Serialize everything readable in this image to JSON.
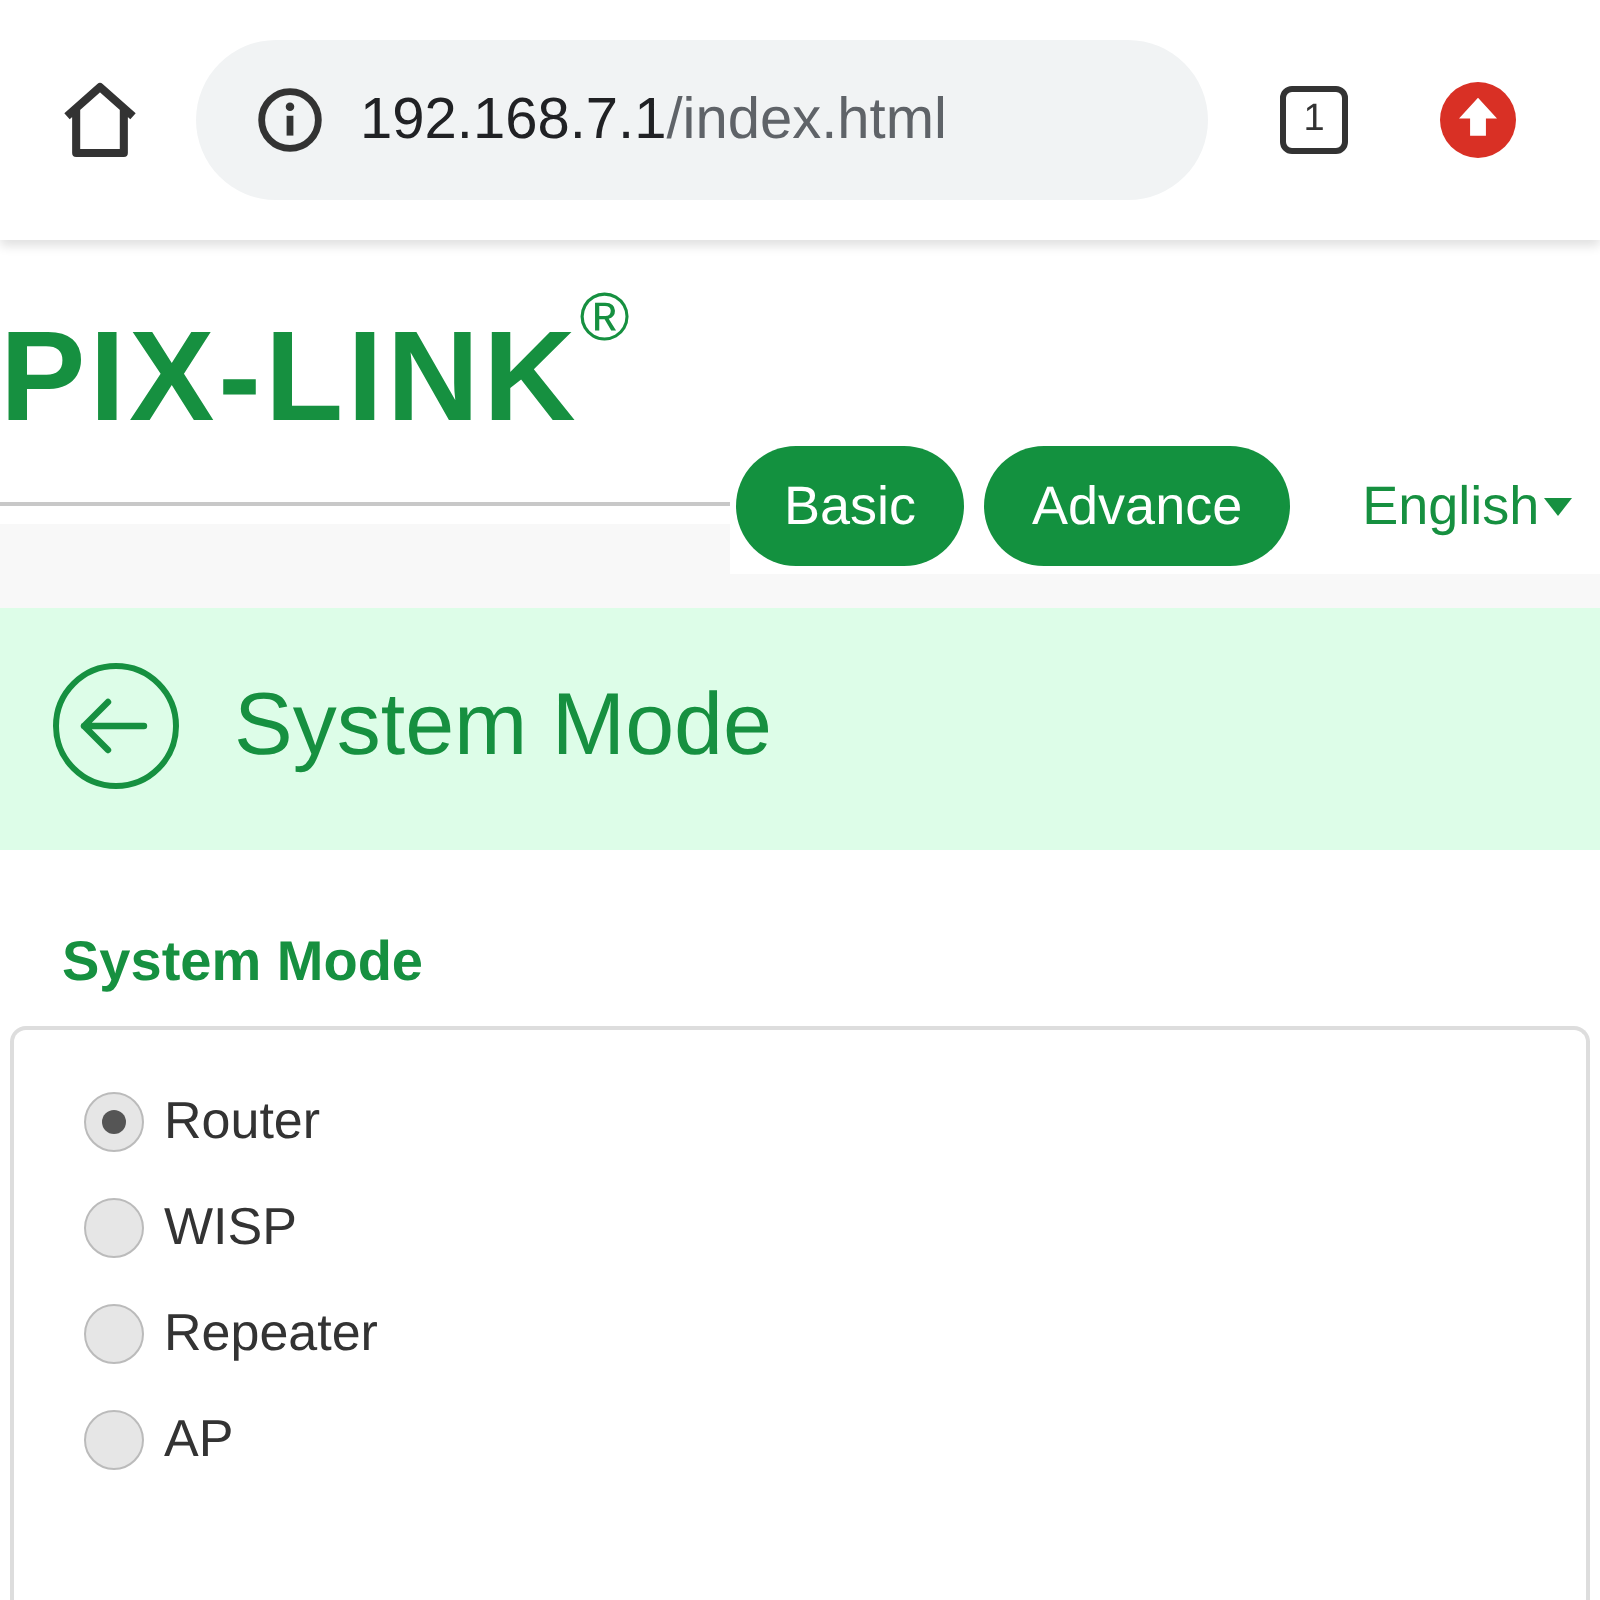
{
  "browser": {
    "url_host": "192.168.7.1",
    "url_path": "/index.html",
    "tab_count": "1"
  },
  "logo": {
    "text": "PIX-LINK$^{®}$"
  },
  "nav": {
    "tabs": [
      {
        "label": "Basic"
      },
      {
        "label": "Advance"
      }
    ],
    "language": "English"
  },
  "header": {
    "title": "System Mode"
  },
  "section": {
    "title": "System Mode",
    "options": [
      {
        "label": "Router",
        "selected": true
      },
      {
        "label": "WISP",
        "selected": false
      },
      {
        "label": "Repeater",
        "selected": false
      },
      {
        "label": "AP",
        "selected": false
      }
    ]
  }
}
